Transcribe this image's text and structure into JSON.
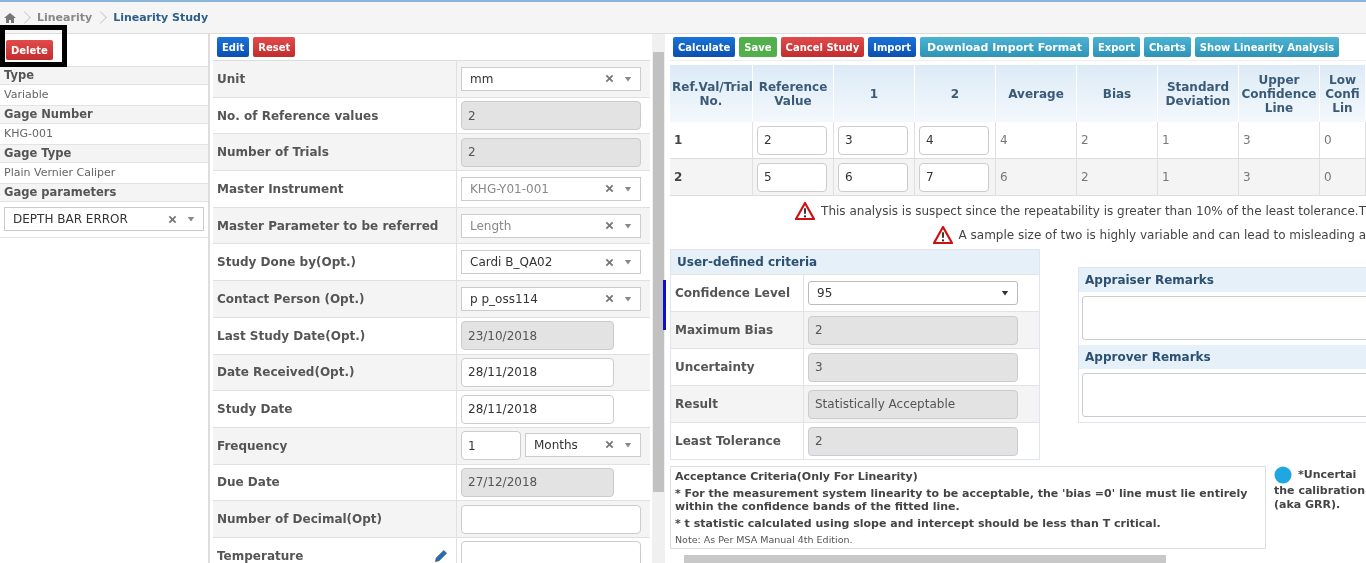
{
  "breadcrumb": {
    "items": [
      {
        "label": "Linearity",
        "current": false
      },
      {
        "label": "Linearity Study",
        "current": true
      }
    ]
  },
  "sidebar": {
    "buttons": [
      {
        "label": "Delete",
        "kind": "danger"
      }
    ],
    "fields": [
      {
        "label": "Type",
        "value": "Variable",
        "kind": "text"
      },
      {
        "label": "Gage Number",
        "value": "KHG-001",
        "kind": "text"
      },
      {
        "label": "Gage Type",
        "value": "Plain Vernier Caliper",
        "kind": "text"
      },
      {
        "label": "Gage parameters",
        "value": "DEPTH BAR ERROR",
        "kind": "select"
      }
    ]
  },
  "form": {
    "buttons": [
      {
        "label": "Edit",
        "kind": "primary"
      },
      {
        "label": "Reset",
        "kind": "danger"
      }
    ],
    "rows": [
      {
        "label": "Unit",
        "kind": "select",
        "value": "mm",
        "disabled": false
      },
      {
        "label": "No. of Reference values",
        "kind": "input",
        "value": "2",
        "disabled": true
      },
      {
        "label": "Number of Trials",
        "kind": "input",
        "value": "2",
        "disabled": true
      },
      {
        "label": "Master Instrument",
        "kind": "select",
        "value": "KHG-Y01-001",
        "disabled": true
      },
      {
        "label": "Master Parameter to be referred",
        "kind": "select",
        "value": "Length",
        "disabled": true
      },
      {
        "label": "Study Done by(Opt.)",
        "kind": "select",
        "value": "Cardi B_QA02",
        "disabled": false
      },
      {
        "label": "Contact Person (Opt.)",
        "kind": "select",
        "value": "p p_oss114",
        "disabled": false
      },
      {
        "label": "Last Study Date(Opt.)",
        "kind": "date",
        "value": "23/10/2018",
        "disabled": true
      },
      {
        "label": "Date Received(Opt.)",
        "kind": "date",
        "value": "28/11/2018",
        "disabled": false
      },
      {
        "label": "Study Date",
        "kind": "date",
        "value": "28/11/2018",
        "disabled": false
      },
      {
        "label": "Frequency",
        "kind": "pair",
        "value": "1",
        "unit": "Months",
        "disabled": false
      },
      {
        "label": "Due Date",
        "kind": "date",
        "value": "27/12/2018",
        "disabled": true
      },
      {
        "label": "Number of Decimal(Opt)",
        "kind": "input",
        "disabled": false
      },
      {
        "label": "Temperature",
        "kind": "input-edit",
        "disabled": false
      }
    ]
  },
  "toolbar": {
    "buttons": [
      {
        "label": "Calculate",
        "kind": "primary"
      },
      {
        "label": "Save",
        "kind": "success"
      },
      {
        "label": "Cancel Study",
        "kind": "danger"
      },
      {
        "label": "Import",
        "kind": "primary"
      },
      {
        "label": "Download Import Format",
        "kind": "info-large"
      },
      {
        "label": "Export",
        "kind": "info"
      },
      {
        "label": "Charts",
        "kind": "info"
      },
      {
        "label": "Show Linearity Analysis",
        "kind": "info"
      }
    ]
  },
  "table": {
    "columns": [
      "Ref.Val/Trial No.",
      "Reference Value",
      "1",
      "2",
      "Average",
      "Bias",
      "Standard Deviation",
      "Upper Confidence Line",
      "Low Confi Lin"
    ],
    "rows": [
      [
        "1",
        "2",
        "3",
        "4",
        "4",
        "2",
        "1",
        "3",
        "0"
      ],
      [
        "2",
        "5",
        "6",
        "7",
        "6",
        "2",
        "1",
        "3",
        "0"
      ]
    ]
  },
  "warnings": [
    "This analysis is suspect since the repeatability is greater than 10% of the least tolerance.T",
    "A sample size of two is highly variable and can lead to misleading a"
  ],
  "criteria": {
    "title": "User-defined criteria",
    "rows": [
      {
        "label": "Confidence Level",
        "kind": "select",
        "value": "95"
      },
      {
        "label": "Maximum Bias",
        "kind": "readonly",
        "value": "2"
      },
      {
        "label": "Uncertainty",
        "kind": "readonly",
        "value": "3"
      },
      {
        "label": "Result",
        "kind": "readonly",
        "value": "Statistically Acceptable"
      },
      {
        "label": "Least Tolerance",
        "kind": "readonly",
        "value": "2"
      }
    ]
  },
  "remarks": [
    {
      "title": "Appraiser Remarks"
    },
    {
      "title": "Approver Remarks"
    }
  ],
  "acceptance": {
    "title": "Acceptance Criteria(Only For Linearity)",
    "items": [
      "* For the measurement system linearity to be acceptable, the 'bias =0' line must lie entirely within the confidence bands of the fitted line.",
      "* t statistic calculated using slope and intercept should be less than T critical."
    ],
    "note": "Note: As Per MSA Manual 4th Edition."
  },
  "info": {
    "lines": [
      "*Uncertai",
      "the calibration",
      "(aka GRR)."
    ]
  }
}
